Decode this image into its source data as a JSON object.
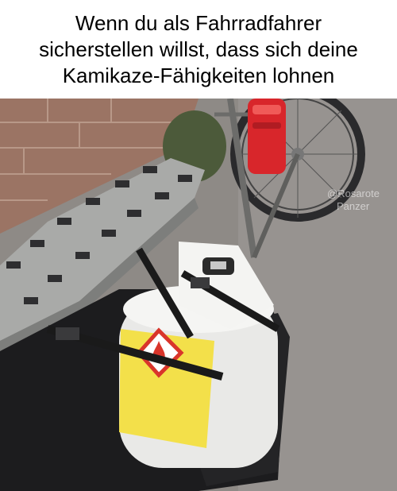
{
  "caption": {
    "line1": "Wenn du als Fahrradfahrer",
    "line2": "sicherstellen willst, dass sich deine",
    "line3": "Kamikaze-Fähigkeiten lohnen"
  },
  "watermark": {
    "line1": "@Rosarote",
    "line2": "Panzer"
  },
  "colors": {
    "background": "#ffffff",
    "text": "#000000",
    "brick": "#a07868",
    "pavement": "#8e8a86",
    "rack": "#a9aaa8",
    "bag": "#1c1c1e",
    "cylinder": "#e9e9e7",
    "hazard_label": "#f3e04a",
    "hazard_red": "#d9352b",
    "reflector": "#d8262b"
  }
}
